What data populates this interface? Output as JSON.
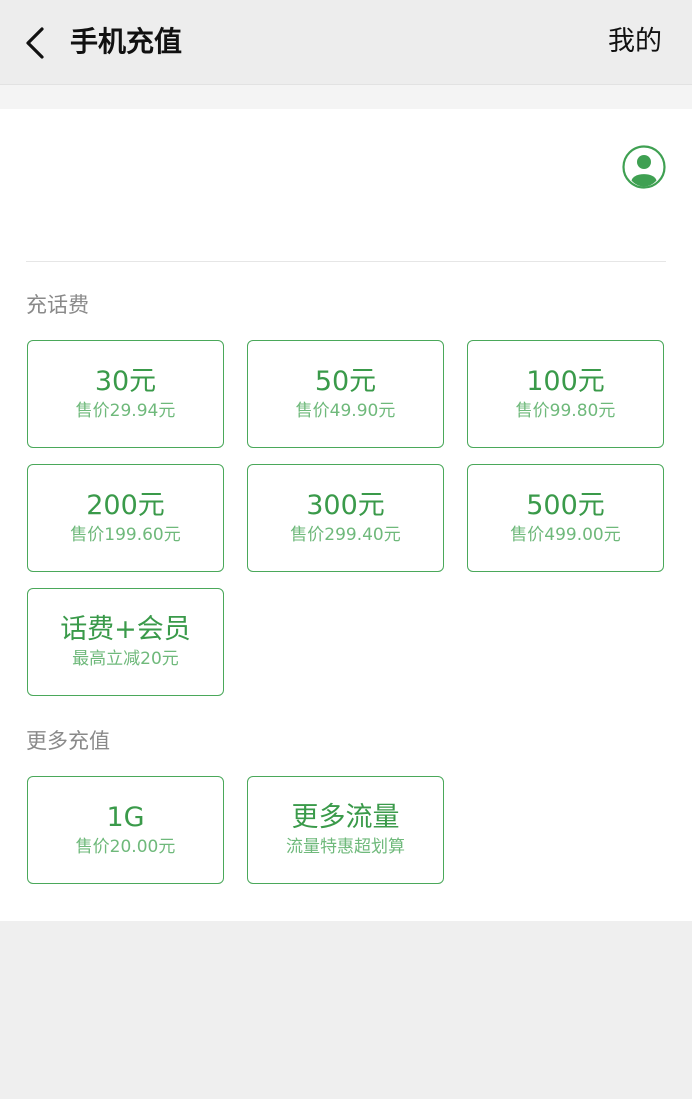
{
  "header": {
    "back_icon": "chevron-left-icon",
    "title": "手机充值",
    "mine_label": "我的"
  },
  "phone": {
    "value": "",
    "placeholder": "",
    "contact_icon": "contact-person-icon"
  },
  "sections": {
    "recharge_title": "充话费",
    "more_title": "更多充值"
  },
  "recharge_options": [
    {
      "amount": "30元",
      "price": "售价29.94元"
    },
    {
      "amount": "50元",
      "price": "售价49.90元"
    },
    {
      "amount": "100元",
      "price": "售价99.80元"
    },
    {
      "amount": "200元",
      "price": "售价199.60元"
    },
    {
      "amount": "300元",
      "price": "售价299.40元"
    },
    {
      "amount": "500元",
      "price": "售价499.00元"
    },
    {
      "amount": "话费+会员",
      "price": "最高立减20元"
    }
  ],
  "more_options": [
    {
      "amount": "1G",
      "price": "售价20.00元"
    },
    {
      "amount": "更多流量",
      "price": "流量特惠超划算"
    }
  ],
  "colors": {
    "accent": "#3a9a4a",
    "accent_light": "#6fb97b",
    "border": "#4aa85a",
    "background": "#efefef"
  }
}
